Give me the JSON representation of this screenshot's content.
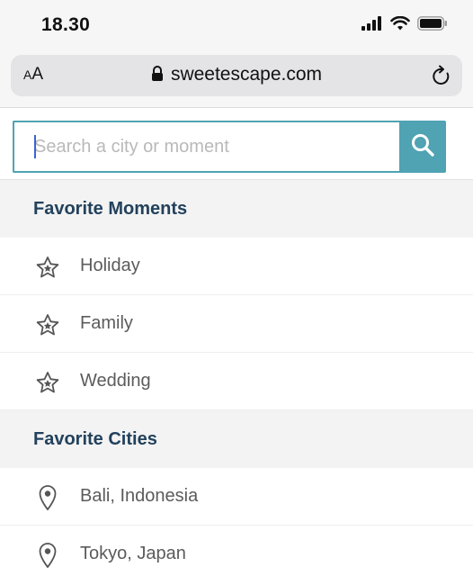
{
  "status_bar": {
    "time": "18.30"
  },
  "browser": {
    "text_size_label_small": "A",
    "text_size_label_large": "A",
    "url": "sweetescape.com"
  },
  "search": {
    "placeholder": "Search a city or moment",
    "value": ""
  },
  "favorite_moments": {
    "header": "Favorite Moments",
    "items": [
      {
        "label": "Holiday",
        "icon": "star-icon"
      },
      {
        "label": "Family",
        "icon": "star-icon"
      },
      {
        "label": "Wedding",
        "icon": "star-icon"
      }
    ]
  },
  "favorite_cities": {
    "header": "Favorite Cities",
    "items": [
      {
        "label": "Bali, Indonesia",
        "icon": "map-pin-icon"
      },
      {
        "label": "Tokyo, Japan",
        "icon": "map-pin-icon"
      }
    ]
  },
  "colors": {
    "accent": "#4fa3b3",
    "header_text": "#22415c",
    "section_bg": "#f3f3f3"
  }
}
